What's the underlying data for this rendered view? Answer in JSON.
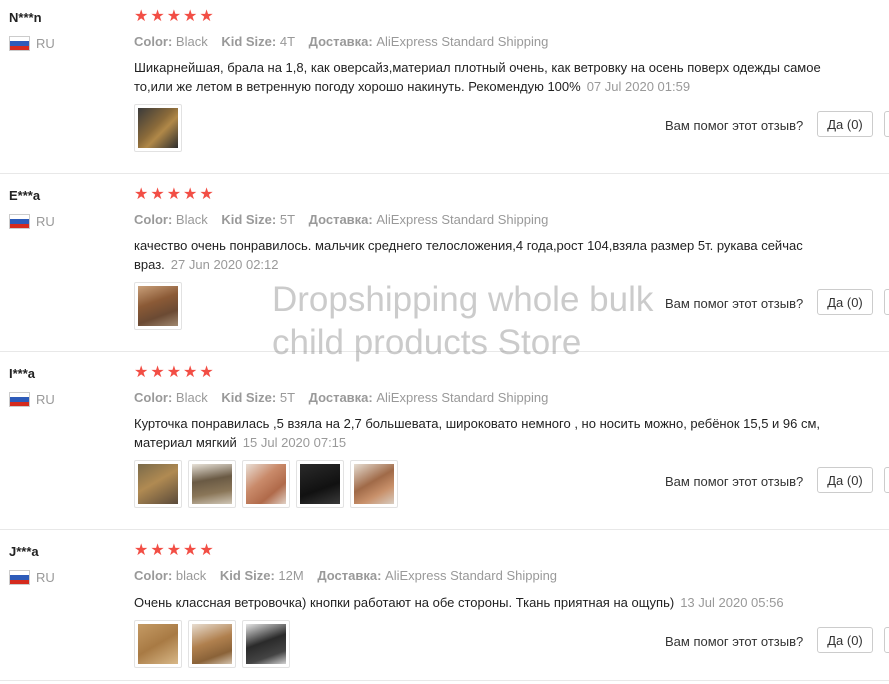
{
  "labels": {
    "color": "Color:",
    "kid_size": "Kid Size:",
    "delivery": "Доставка:",
    "helpful": "Вам помог этот отзыв?"
  },
  "reviews": [
    {
      "user": "N***n",
      "country": "RU",
      "stars": 5,
      "color": "Black",
      "size": "4T",
      "shipping": "AliExpress Standard Shipping",
      "text": "Шикарнейшая, брала на 1,8, как оверсайз,материал плотный очень, как ветровку на осень поверх одежды самое то,или же летом в ветренную погоду хорошо накинуть. Рекомендую 100%",
      "date": "07 Jul 2020 01:59",
      "yes_label": "Да (0)",
      "photos": [
        "photo-1"
      ]
    },
    {
      "user": "E***a",
      "country": "RU",
      "stars": 5,
      "color": "Black",
      "size": "5T",
      "shipping": "AliExpress Standard Shipping",
      "text": "качество очень понравилось. мальчик среднего телосложения,4 года,рост 104,взяла размер 5т. рукава сейчас враз.",
      "date": "27 Jun 2020 02:12",
      "yes_label": "Да (0)",
      "photos": [
        "photo-1"
      ]
    },
    {
      "user": "I***a",
      "country": "RU",
      "stars": 5,
      "color": "Black",
      "size": "5T",
      "shipping": "AliExpress Standard Shipping",
      "text": "Курточка понравилась ,5 взяла на 2,7 большевата, широковато немного , но носить можно, ребёнок 15,5 и 96 см, материал мягкий",
      "date": "15 Jul 2020 07:15",
      "yes_label": "Да (0)",
      "photos": [
        "photo-1",
        "photo-2",
        "photo-3",
        "photo-4",
        "photo-5"
      ]
    },
    {
      "user": "J***a",
      "country": "RU",
      "stars": 5,
      "color": "black",
      "size": "12M",
      "shipping": "AliExpress Standard Shipping",
      "text": "Очень классная ветровочка) кнопки работают на обе стороны. Ткань приятная на ощупь)",
      "date": "13 Jul 2020 05:56",
      "yes_label": "Да (0)",
      "photos": [
        "photo-1",
        "photo-2",
        "photo-3"
      ]
    }
  ],
  "watermark": {
    "line1": "Dropshipping whole bulk",
    "line2": "child products Store"
  },
  "colors": {
    "star": "#f24e45",
    "muted": "#999999",
    "flag_white": "#ffffff",
    "flag_blue": "#2d5bb9",
    "flag_red": "#d52b1e"
  }
}
